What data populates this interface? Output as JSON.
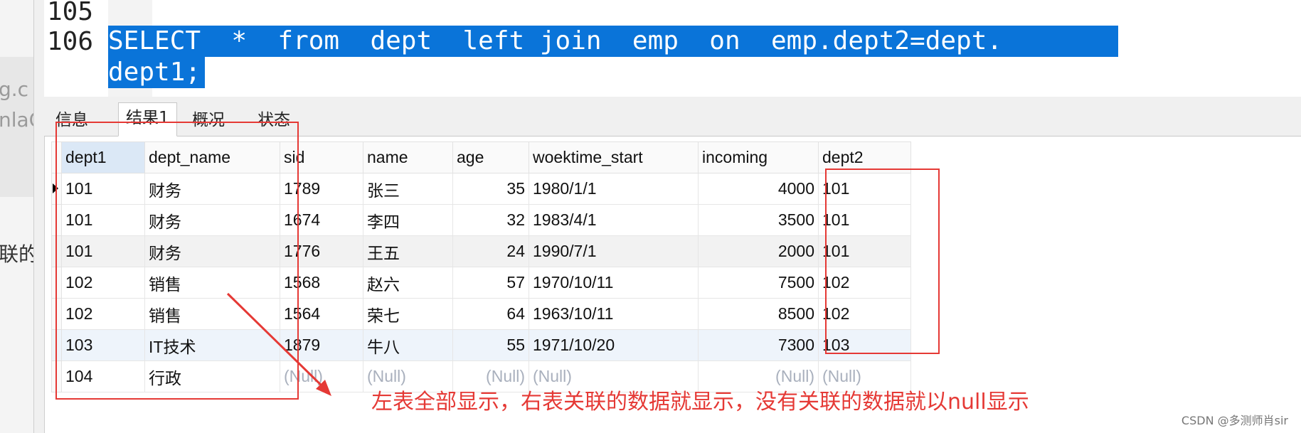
{
  "blog_fragments": [
    "g.c",
    "nlaC",
    "联的"
  ],
  "editor": {
    "lines": [
      {
        "no": "105",
        "text": ""
      },
      {
        "no": "106",
        "text": "SELECT  *  from  dept  left join  emp  on  emp.dept2=dept."
      },
      {
        "no": "",
        "text": "dept1;"
      }
    ]
  },
  "tabs": [
    {
      "label": "信息",
      "active": false
    },
    {
      "label": "结果1",
      "active": true
    },
    {
      "label": "概况",
      "active": false
    },
    {
      "label": "状态",
      "active": false
    }
  ],
  "grid": {
    "columns": [
      "dept1",
      "dept_name",
      "sid",
      "name",
      "age",
      "woektime_start",
      "incoming",
      "dept2"
    ],
    "rows": [
      [
        "101",
        "财务",
        "1789",
        "张三",
        "35",
        "1980/1/1",
        "4000",
        "101"
      ],
      [
        "101",
        "财务",
        "1674",
        "李四",
        "32",
        "1983/4/1",
        "3500",
        "101"
      ],
      [
        "101",
        "财务",
        "1776",
        "王五",
        "24",
        "1990/7/1",
        "2000",
        "101"
      ],
      [
        "102",
        "销售",
        "1568",
        "赵六",
        "57",
        "1970/10/11",
        "7500",
        "102"
      ],
      [
        "102",
        "销售",
        "1564",
        "荣七",
        "64",
        "1963/10/11",
        "8500",
        "102"
      ],
      [
        "103",
        "IT技术",
        "1879",
        "牛八",
        "55",
        "1971/10/20",
        "7300",
        "103"
      ],
      [
        "104",
        "行政",
        "(Null)",
        "(Null)",
        "(Null)",
        "(Null)",
        "(Null)",
        "(Null)"
      ]
    ]
  },
  "annotation": {
    "note": "左表全部显示，右表关联的数据就显示，没有关联的数据就以null显示",
    "color": "#e53935"
  },
  "watermark": "CSDN @多测师肖sir"
}
